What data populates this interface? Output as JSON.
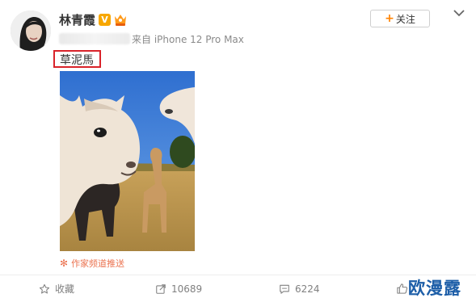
{
  "post": {
    "author": {
      "name": "林青霞",
      "verified_label": "V",
      "avatar_icon": "user-avatar"
    },
    "follow_button": {
      "plus": "+",
      "label": "关注"
    },
    "source": "来自 iPhone 12 Pro Max",
    "text": "草泥馬",
    "highlight_color": "#d9232a",
    "image": {
      "subject": "alpacas-photo"
    },
    "channel_link": {
      "icon": "spark-icon",
      "label": "作家频道推送"
    }
  },
  "actions": {
    "favorite": {
      "label": "收藏",
      "icon": "star-icon"
    },
    "repost": {
      "count": "10689",
      "icon": "repost-icon"
    },
    "comment": {
      "count": "6224",
      "icon": "comment-icon"
    },
    "like": {
      "icon": "thumbs-up-icon"
    }
  },
  "watermark": "欧漫露",
  "colors": {
    "accent": "#ff8200",
    "link": "#eb7350",
    "muted": "#808080",
    "watermark": "#1d5ea8"
  }
}
